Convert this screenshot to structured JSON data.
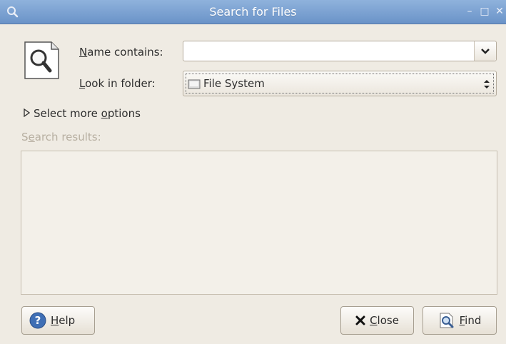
{
  "window": {
    "title": "Search for Files",
    "controls": [
      "minimize-icon",
      "maximize-icon",
      "close-icon"
    ]
  },
  "form": {
    "name_label_mnemonic": "N",
    "name_label_rest": "ame contains:",
    "name_value": "",
    "look_label_mnemonic": "L",
    "look_label_rest": "ook in folder:",
    "folder_value": "File System"
  },
  "expander": {
    "text_before": "Select more ",
    "mnemonic": "o",
    "text_after": "ptions"
  },
  "results": {
    "label_first": "S",
    "label_mnemonic": "e",
    "label_rest": "arch results:"
  },
  "buttons": {
    "help_mnemonic": "H",
    "help_rest": "elp",
    "close_mnemonic": "C",
    "close_rest": "lose",
    "find_mnemonic": "F",
    "find_rest": "ind"
  },
  "colors": {
    "titlebar": "#7ea3d3",
    "window_bg": "#efebe3",
    "help_icon": "#3f6fb5"
  }
}
